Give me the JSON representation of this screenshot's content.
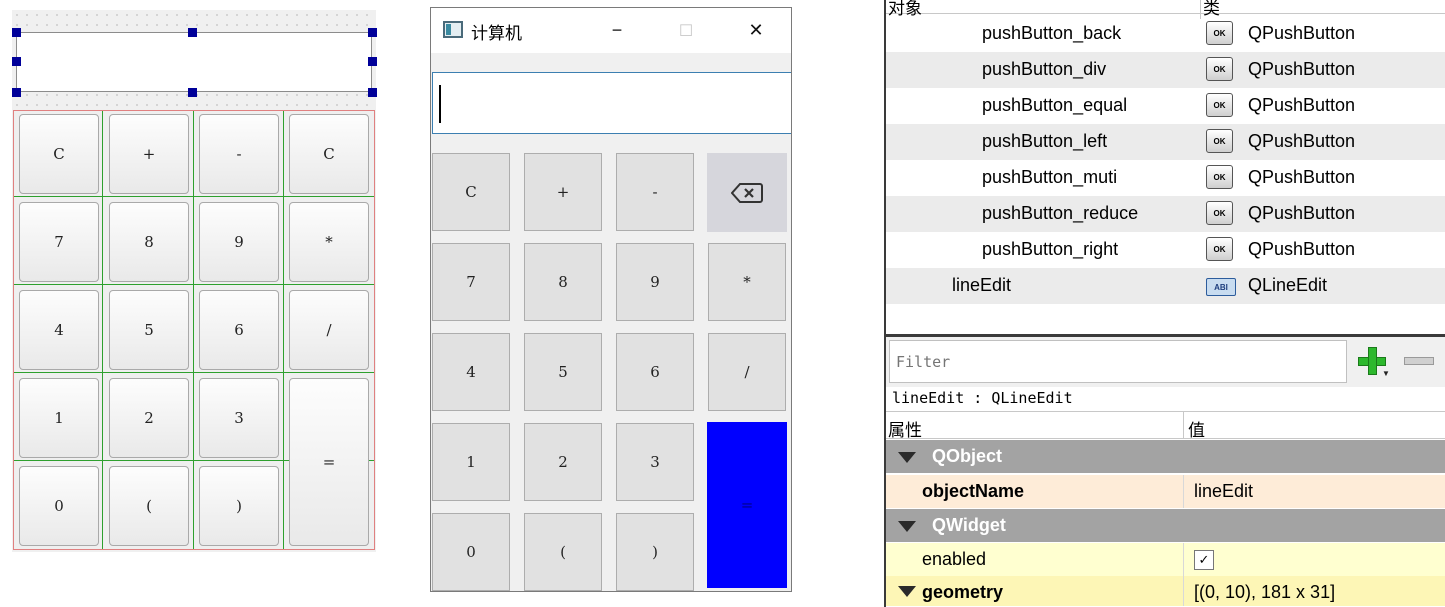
{
  "designer": {
    "buttons": [
      "C",
      "+",
      "-",
      "C",
      "7",
      "8",
      "9",
      "*",
      "4",
      "5",
      "6",
      "/",
      "1",
      "2",
      "3",
      "=",
      "0",
      "(",
      ")"
    ]
  },
  "calculator": {
    "title": "计算机",
    "minimize": "−",
    "maximize": "☐",
    "close": "✕",
    "buttons": [
      "C",
      "+",
      "-",
      "⌫",
      "7",
      "8",
      "9",
      "*",
      "4",
      "5",
      "6",
      "/",
      "1",
      "2",
      "3",
      "=",
      "0",
      "(",
      ")"
    ],
    "equal_color": "#0000ff"
  },
  "inspector": {
    "col_object": "对象",
    "col_class": "类",
    "objects": [
      {
        "name": "pushButton_back",
        "class": "QPushButton"
      },
      {
        "name": "pushButton_div",
        "class": "QPushButton"
      },
      {
        "name": "pushButton_equal",
        "class": "QPushButton"
      },
      {
        "name": "pushButton_left",
        "class": "QPushButton"
      },
      {
        "name": "pushButton_muti",
        "class": "QPushButton"
      },
      {
        "name": "pushButton_reduce",
        "class": "QPushButton"
      },
      {
        "name": "pushButton_right",
        "class": "QPushButton"
      },
      {
        "name": "lineEdit",
        "class": "QLineEdit"
      }
    ],
    "ok_icon_text": "OK",
    "le_icon_text": "ABI"
  },
  "property_editor": {
    "filter_placeholder": "Filter",
    "selection_label": "lineEdit : QLineEdit",
    "col_property": "属性",
    "col_value": "值",
    "rows": {
      "qobject": "QObject",
      "objectname_key": "objectName",
      "objectname_val": "lineEdit",
      "qwidget": "QWidget",
      "enabled_key": "enabled",
      "enabled_check": "✓",
      "geometry_key": "geometry",
      "geometry_val": "[(0, 10), 181 x 31]"
    }
  }
}
